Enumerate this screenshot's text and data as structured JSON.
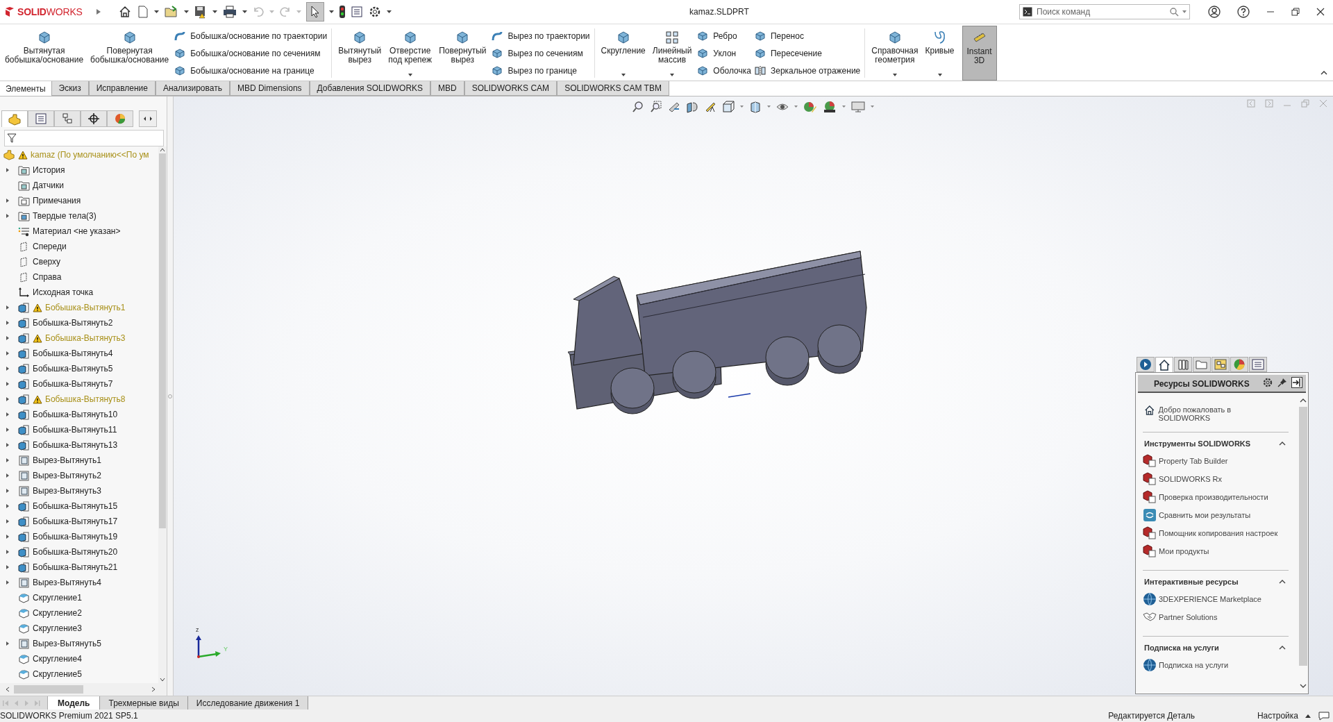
{
  "title_bar": {
    "logo": "**SOLID**WORKS",
    "title": "kamaz.SLDPRT",
    "search": {
      "placeholder": "Поиск команд"
    }
  },
  "ribbon": {
    "groups": [
      {
        "items": [
          {
            "kind": "large",
            "label": "Вытянутая\nбобышка/основание",
            "dropdown": false,
            "selected": false
          },
          {
            "kind": "large",
            "label": "Повернутая\nбобышка/основание",
            "dropdown": false,
            "selected": false
          },
          {
            "kind": "stack",
            "items": [
              {
                "label": "Бобышка/основание по траектории"
              },
              {
                "label": "Бобышка/основание по сечениям"
              },
              {
                "label": "Бобышка/основание на границе"
              }
            ]
          }
        ]
      },
      {
        "items": [
          {
            "kind": "large",
            "label": "Вытянутый\nвырез",
            "dropdown": false,
            "selected": false
          },
          {
            "kind": "large",
            "label": "Отверстие\nпод крепеж",
            "dropdown": true,
            "selected": false
          },
          {
            "kind": "large",
            "label": "Повернутый\nвырез",
            "dropdown": false,
            "selected": false
          },
          {
            "kind": "stack",
            "items": [
              {
                "label": "Вырез по траектории"
              },
              {
                "label": "Вырез по сечениям"
              },
              {
                "label": "Вырез по границе"
              }
            ]
          }
        ]
      },
      {
        "items": [
          {
            "kind": "large",
            "label": "Скругление",
            "dropdown": true,
            "selected": false
          },
          {
            "kind": "large",
            "label": "Линейный\nмассив",
            "dropdown": true,
            "selected": false
          },
          {
            "kind": "stack",
            "items": [
              {
                "label": "Ребро"
              },
              {
                "label": "Уклон"
              },
              {
                "label": "Оболочка"
              }
            ]
          },
          {
            "kind": "stack",
            "items": [
              {
                "label": "Перенос"
              },
              {
                "label": "Пересечение"
              },
              {
                "label": "Зеркальное отражение"
              }
            ]
          }
        ]
      },
      {
        "items": [
          {
            "kind": "large",
            "label": "Справочная\nгеометрия",
            "dropdown": true,
            "selected": false
          },
          {
            "kind": "large",
            "label": "Кривые",
            "dropdown": true,
            "selected": false
          }
        ]
      },
      {
        "items": [
          {
            "kind": "large",
            "label": "Instant\n3D",
            "dropdown": false,
            "selected": true
          }
        ]
      }
    ]
  },
  "tabs": [
    {
      "label": "Элементы",
      "selected": true
    },
    {
      "label": "Эскиз",
      "selected": false
    },
    {
      "label": "Исправление",
      "selected": false
    },
    {
      "label": "Анализировать",
      "selected": false
    },
    {
      "label": "MBD Dimensions",
      "selected": false
    },
    {
      "label": "Добавления SOLIDWORKS",
      "selected": false
    },
    {
      "label": "MBD",
      "selected": false
    },
    {
      "label": "SOLIDWORKS CAM",
      "selected": false
    },
    {
      "label": "SOLIDWORKS CAM TBM",
      "selected": false
    }
  ],
  "manager_tabs": [
    {
      "kind": "part",
      "selected": true
    },
    {
      "kind": "properties",
      "selected": false
    },
    {
      "kind": "configurations",
      "selected": false
    },
    {
      "kind": "target",
      "selected": false
    },
    {
      "kind": "appearance",
      "selected": false
    }
  ],
  "feature_tree": {
    "root": {
      "label": "kamaz  (По умолчанию<<По ум",
      "warning": true
    },
    "items": [
      {
        "kind": "history",
        "label": "История",
        "expandable": true,
        "warning": false
      },
      {
        "kind": "sensors",
        "label": "Датчики",
        "expandable": false,
        "warning": false
      },
      {
        "kind": "annotations",
        "label": "Примечания",
        "expandable": true,
        "warning": false
      },
      {
        "kind": "bodies",
        "label": "Твердые тела(3)",
        "expandable": true,
        "warning": false
      },
      {
        "kind": "material",
        "label": "Материал <не указан>",
        "expandable": false,
        "warning": false
      },
      {
        "kind": "plane",
        "label": "Спереди",
        "expandable": false,
        "warning": false
      },
      {
        "kind": "plane",
        "label": "Сверху",
        "expandable": false,
        "warning": false
      },
      {
        "kind": "plane",
        "label": "Справа",
        "expandable": false,
        "warning": false
      },
      {
        "kind": "origin",
        "label": "Исходная точка",
        "expandable": false,
        "warning": false
      },
      {
        "kind": "boss",
        "label": "Бобышка-Вытянуть1",
        "expandable": true,
        "warning": true
      },
      {
        "kind": "boss",
        "label": "Бобышка-Вытянуть2",
        "expandable": true,
        "warning": false
      },
      {
        "kind": "boss",
        "label": "Бобышка-Вытянуть3",
        "expandable": true,
        "warning": true
      },
      {
        "kind": "boss",
        "label": "Бобышка-Вытянуть4",
        "expandable": true,
        "warning": false
      },
      {
        "kind": "boss",
        "label": "Бобышка-Вытянуть5",
        "expandable": true,
        "warning": false
      },
      {
        "kind": "boss",
        "label": "Бобышка-Вытянуть7",
        "expandable": true,
        "warning": false
      },
      {
        "kind": "boss",
        "label": "Бобышка-Вытянуть8",
        "expandable": true,
        "warning": true
      },
      {
        "kind": "boss",
        "label": "Бобышка-Вытянуть10",
        "expandable": true,
        "warning": false
      },
      {
        "kind": "boss",
        "label": "Бобышка-Вытянуть11",
        "expandable": true,
        "warning": false
      },
      {
        "kind": "boss",
        "label": "Бобышка-Вытянуть13",
        "expandable": true,
        "warning": false
      },
      {
        "kind": "cut",
        "label": "Вырез-Вытянуть1",
        "expandable": true,
        "warning": false
      },
      {
        "kind": "cut",
        "label": "Вырез-Вытянуть2",
        "expandable": true,
        "warning": false
      },
      {
        "kind": "cut",
        "label": "Вырез-Вытянуть3",
        "expandable": true,
        "warning": false
      },
      {
        "kind": "boss",
        "label": "Бобышка-Вытянуть15",
        "expandable": true,
        "warning": false
      },
      {
        "kind": "boss",
        "label": "Бобышка-Вытянуть17",
        "expandable": true,
        "warning": false
      },
      {
        "kind": "boss",
        "label": "Бобышка-Вытянуть19",
        "expandable": true,
        "warning": false
      },
      {
        "kind": "boss",
        "label": "Бобышка-Вытянуть20",
        "expandable": true,
        "warning": false
      },
      {
        "kind": "boss",
        "label": "Бобышка-Вытянуть21",
        "expandable": true,
        "warning": false
      },
      {
        "kind": "cut",
        "label": "Вырез-Вытянуть4",
        "expandable": true,
        "warning": false
      },
      {
        "kind": "fillet",
        "label": "Скругление1",
        "expandable": false,
        "warning": false
      },
      {
        "kind": "fillet",
        "label": "Скругление2",
        "expandable": false,
        "warning": false
      },
      {
        "kind": "fillet",
        "label": "Скругление3",
        "expandable": false,
        "warning": false
      },
      {
        "kind": "cut",
        "label": "Вырез-Вытянуть5",
        "expandable": true,
        "warning": false
      },
      {
        "kind": "fillet",
        "label": "Скругление4",
        "expandable": false,
        "warning": false
      },
      {
        "kind": "fillet",
        "label": "Скругление5",
        "expandable": false,
        "warning": false
      }
    ]
  },
  "triad": {
    "z": "z",
    "y": "Y"
  },
  "task_pane": {
    "tabs": [
      {
        "kind": "globe",
        "selected": false
      },
      {
        "kind": "home",
        "selected": true
      },
      {
        "kind": "library",
        "selected": false
      },
      {
        "kind": "folder",
        "selected": false
      },
      {
        "kind": "palette",
        "selected": false
      },
      {
        "kind": "sphere",
        "selected": false
      },
      {
        "kind": "list",
        "selected": false
      }
    ],
    "title": "Ресурсы SOLIDWORKS",
    "welcome": "Добро пожаловать в SOLIDWORKS",
    "sections": [
      {
        "title": "Инструменты SOLIDWORKS",
        "expanded": true,
        "items": [
          {
            "kind": "tool",
            "label": "Property Tab Builder"
          },
          {
            "kind": "tool",
            "label": "SOLIDWORKS Rx"
          },
          {
            "kind": "tool",
            "label": "Проверка производительности"
          },
          {
            "kind": "compare",
            "label": "Сравнить мои результаты"
          },
          {
            "kind": "tool",
            "label": "Помощник копирования настроек"
          },
          {
            "kind": "tool",
            "label": "Мои продукты"
          }
        ]
      },
      {
        "title": "Интерактивные ресурсы",
        "expanded": true,
        "items": [
          {
            "kind": "globe",
            "label": "3DEXPERIENCE Marketplace"
          },
          {
            "kind": "handshake",
            "label": "Partner Solutions"
          }
        ]
      },
      {
        "title": "Подписка на услуги",
        "expanded": true,
        "items": [
          {
            "kind": "globe",
            "label": "Подписка на услуги"
          }
        ]
      }
    ]
  },
  "bottom_tabs": [
    {
      "label": "Модель",
      "selected": true
    },
    {
      "label": "Трехмерные виды",
      "selected": false
    },
    {
      "label": "Исследование движения 1",
      "selected": false
    }
  ],
  "status_bar": {
    "product": "SOLIDWORKS Premium 2021 SP5.1",
    "mode": "Редактируется Деталь",
    "units": "Настройка"
  }
}
